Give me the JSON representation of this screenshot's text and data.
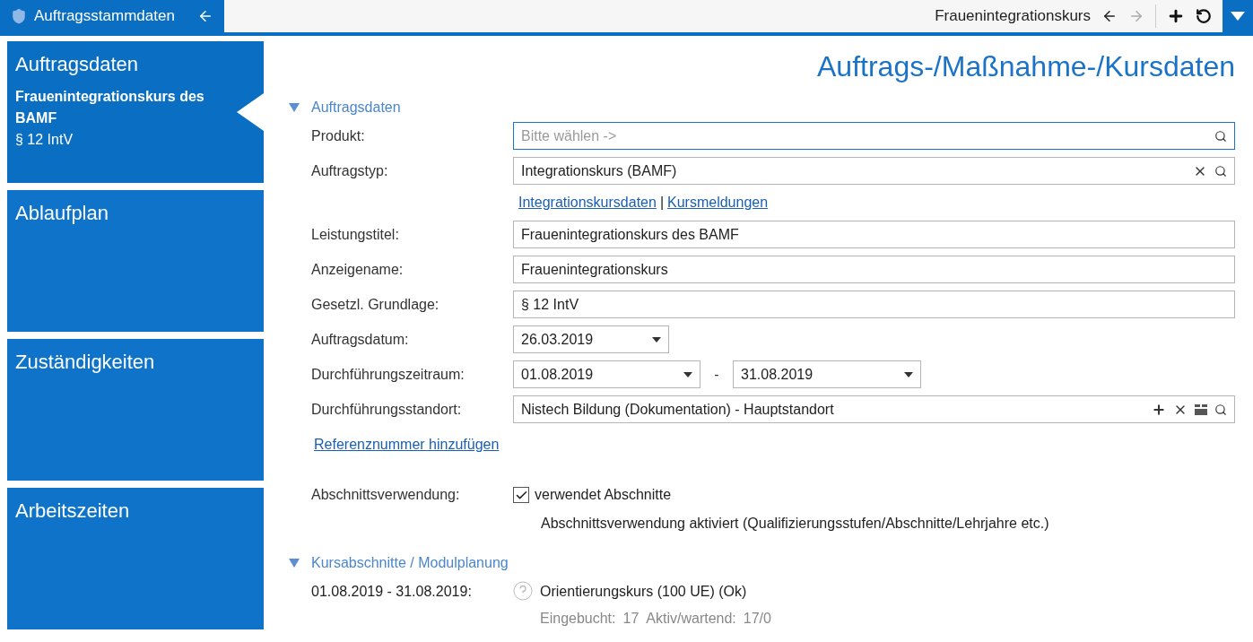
{
  "top_tab": {
    "title": "Auftragsstammdaten"
  },
  "toolbar": {
    "record_title": "Frauenintegrationskurs",
    "back_enabled": true,
    "forward_enabled": false
  },
  "sidebar": {
    "items": [
      {
        "title": "Auftragsdaten",
        "selected": true,
        "subtitle_bold": "Frauenintegrationskurs des BAMF",
        "subtitle": "§ 12 IntV"
      },
      {
        "title": "Ablaufplan",
        "selected": false
      },
      {
        "title": "Zuständigkeiten",
        "selected": false
      },
      {
        "title": "Arbeitszeiten",
        "selected": false
      }
    ]
  },
  "page_title": "Auftrags-/Maßnahme-/Kursdaten",
  "section_1": {
    "title": "Auftragsdaten",
    "expanded": true,
    "rows": [
      {
        "kind": "lookup",
        "label": "Produkt:",
        "placeholder": "Bitte wählen ->",
        "focused": true,
        "clearable": false
      },
      {
        "kind": "lookup",
        "label": "Auftragstyp:",
        "value": "Integrationskurs (BAMF)",
        "focused": false,
        "clearable": true
      },
      {
        "kind": "links",
        "links": [
          "Integrationskursdaten",
          "Kursmeldungen"
        ],
        "separator": "|"
      },
      {
        "kind": "text",
        "label": "Leistungstitel:",
        "value": "Frauenintegrationskurs des BAMF"
      },
      {
        "kind": "text",
        "label": "Anzeigename:",
        "value": "Frauenintegrationskurs"
      },
      {
        "kind": "text",
        "label": "Gesetzl. Grundlage:",
        "value": "§ 12 IntV"
      },
      {
        "kind": "date",
        "label": "Auftragsdatum:",
        "value": "26.03.2019"
      },
      {
        "kind": "range",
        "label": "Durchführungszeitraum:",
        "from": "01.08.2019",
        "separator": "-",
        "to": "31.08.2019"
      },
      {
        "kind": "location",
        "label": "Durchführungsstandort:",
        "value": "Nistech Bildung (Dokumentation) - Hauptstandort"
      }
    ],
    "add_link": "Referenznummer hinzufügen",
    "usage_label": "Abschnittsverwendung:",
    "usage_checkbox": {
      "label": "verwendet Abschnitte",
      "checked": true
    },
    "usage_note": "Abschnittsverwendung aktiviert (Qualifizierungsstufen/Abschnitte/Lehrjahre etc.)"
  },
  "section_2": {
    "title": "Kursabschnitte / Modulplanung",
    "expanded": true,
    "entries": [
      {
        "period": "01.08.2019 - 31.08.2019:",
        "name": "Orientierungskurs (100 UE) (Ok)",
        "booked_label": "Eingebucht:",
        "booked": "17",
        "active_label": "Aktiv/wartend:",
        "active": "17/0"
      }
    ]
  }
}
